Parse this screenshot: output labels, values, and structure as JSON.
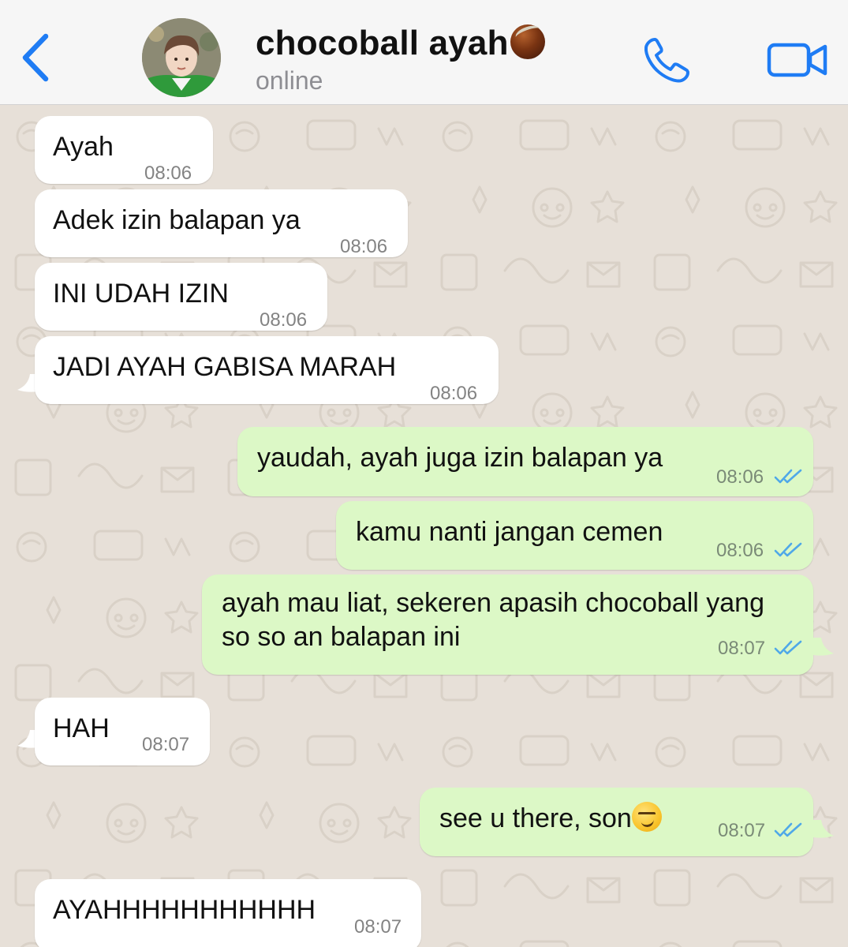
{
  "header": {
    "contact_name": "chocoball ayah",
    "status": "online",
    "icons": {
      "back": "chevron-left-icon",
      "call": "phone-icon",
      "video": "video-camera-icon",
      "name_emoji": "chestnut-emoji"
    },
    "accent_color": "#1f7cf4"
  },
  "messages": [
    {
      "direction": "in",
      "text": "Ayah",
      "time": "08:06"
    },
    {
      "direction": "in",
      "text": "Adek izin balapan ya",
      "time": "08:06"
    },
    {
      "direction": "in",
      "text": "INI UDAH IZIN",
      "time": "08:06"
    },
    {
      "direction": "in",
      "text": "JADI AYAH GABISA MARAH",
      "time": "08:06"
    },
    {
      "direction": "out",
      "text": "yaudah, ayah juga izin balapan ya",
      "time": "08:06",
      "read": true
    },
    {
      "direction": "out",
      "text": "kamu nanti jangan cemen",
      "time": "08:06",
      "read": true
    },
    {
      "direction": "out",
      "text": "ayah mau liat, sekeren apasih chocoball yang\nso so an balapan ini",
      "time": "08:07",
      "read": true
    },
    {
      "direction": "in",
      "text": "HAH",
      "time": "08:07"
    },
    {
      "direction": "out",
      "text": "see u there, son",
      "emoji": "smirking-face",
      "time": "08:07",
      "read": true
    },
    {
      "direction": "in",
      "text": "AYAHHHHHHHHHHH",
      "time": "08:07"
    }
  ],
  "colors": {
    "wallpaper": "#e7e0d8",
    "incoming_bubble": "#ffffff",
    "outgoing_bubble": "#dcf8c6",
    "read_ticks": "#4fa8e8"
  }
}
